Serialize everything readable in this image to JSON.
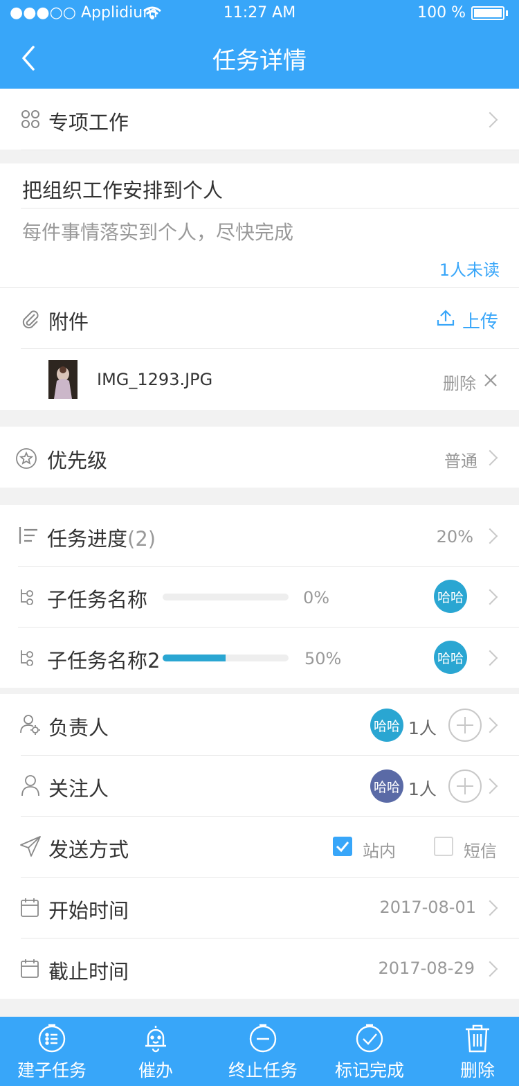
{
  "status": {
    "carrier": "●●●○○ Applidium",
    "time": "11:27 AM",
    "battery": "100 %"
  },
  "nav": {
    "title": "任务详情"
  },
  "special": {
    "label": "专项工作"
  },
  "task": {
    "title": "把组织工作安排到个人",
    "desc": "每件事情落实到个人，尽快完成",
    "unread": "1人未读"
  },
  "attachments": {
    "label": "附件",
    "upload": "上传",
    "files": [
      {
        "name": "IMG_1293.JPG",
        "delete": "删除"
      }
    ]
  },
  "priority": {
    "label": "优先级",
    "value": "普通"
  },
  "progress": {
    "label": "任务进度",
    "count": "(2)",
    "value": "20%",
    "subtasks": [
      {
        "name": "子任务名称",
        "percent": "0%",
        "fraction": 0,
        "assignee": "哈哈"
      },
      {
        "name": "子任务名称2",
        "percent": "50%",
        "fraction": 0.5,
        "assignee": "哈哈"
      }
    ]
  },
  "owner": {
    "label": "负责人",
    "avatar": "哈哈",
    "count": "1人",
    "avatar_color": "#2aa6d2"
  },
  "follower": {
    "label": "关注人",
    "avatar": "哈哈",
    "count": "1人",
    "avatar_color": "#5a6aa6"
  },
  "send": {
    "label": "发送方式",
    "opt1": "站内",
    "opt1_checked": true,
    "opt2": "短信",
    "opt2_checked": false
  },
  "start": {
    "label": "开始时间",
    "value": "2017-08-01"
  },
  "end": {
    "label": "截止时间",
    "value": "2017-08-29"
  },
  "tabbar": {
    "items": [
      "建子任务",
      "催办",
      "终止任务",
      "标记完成",
      "删除"
    ]
  },
  "colors": {
    "primary": "#38a6f9",
    "accent_link": "#38a6f9",
    "progress_fill": "#2aa6d2"
  }
}
